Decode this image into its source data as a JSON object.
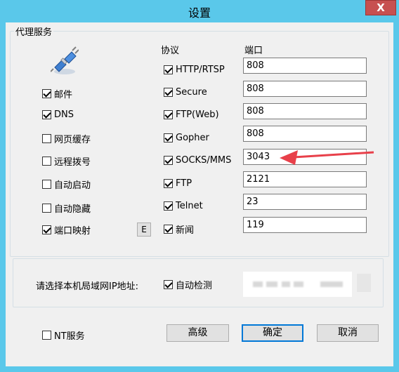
{
  "window": {
    "title": "设置",
    "close_label": "X"
  },
  "proxy_group": {
    "legend": "代理服务"
  },
  "services": [
    {
      "label": "邮件",
      "checked": true
    },
    {
      "label": "DNS",
      "checked": true
    },
    {
      "label": "网页缓存",
      "checked": false
    },
    {
      "label": "远程拨号",
      "checked": false
    },
    {
      "label": "自动启动",
      "checked": false
    },
    {
      "label": "自动隐藏",
      "checked": false
    },
    {
      "label": "端口映射",
      "checked": true
    }
  ],
  "port_mapping_button": "E",
  "headers": {
    "protocol": "协议",
    "port": "端口"
  },
  "protocols": [
    {
      "label": "HTTP/RTSP",
      "checked": true,
      "port": "808"
    },
    {
      "label": "Secure",
      "checked": true,
      "port": "808"
    },
    {
      "label": "FTP(Web)",
      "checked": true,
      "port": "808"
    },
    {
      "label": "Gopher",
      "checked": true,
      "port": "808"
    },
    {
      "label": "SOCKS/MMS",
      "checked": true,
      "port": "3043"
    },
    {
      "label": "FTP",
      "checked": true,
      "port": "2121"
    },
    {
      "label": "Telnet",
      "checked": true,
      "port": "23"
    },
    {
      "label": "新闻",
      "checked": true,
      "port": "119"
    }
  ],
  "lan": {
    "label": "请选择本机局域网IP地址:",
    "auto_detect": "自动检测",
    "auto_detect_checked": true
  },
  "footer": {
    "nt_service": "NT服务",
    "nt_service_checked": false,
    "advanced": "高级",
    "ok": "确定",
    "cancel": "取消"
  },
  "colors": {
    "title_bar": "#5ac8ea",
    "close": "#c75050",
    "arrow": "#e8404a",
    "accent": "#0078d7"
  }
}
